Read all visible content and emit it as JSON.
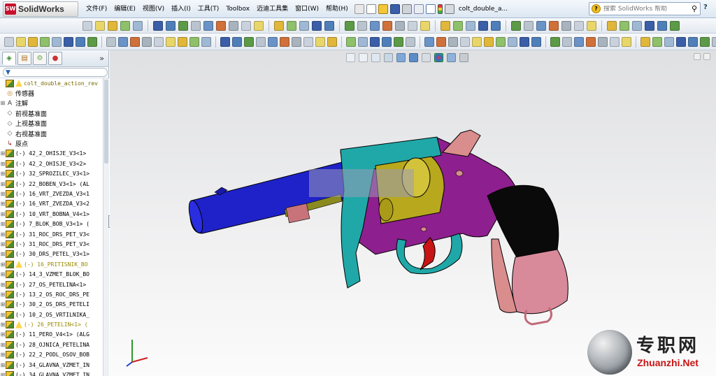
{
  "app": {
    "name": "SolidWorks",
    "logo_mark": "SW"
  },
  "menu": [
    "文件(F)",
    "编辑(E)",
    "视图(V)",
    "插入(I)",
    "工具(T)",
    "Toolbox",
    "迈迪工具集",
    "窗口(W)",
    "帮助(H)"
  ],
  "document_title": "colt_double_a...",
  "search": {
    "placeholder": "搜索 SolidWorks 帮助"
  },
  "panel": {
    "expand_glyph": "»",
    "filter_glyph": "▼"
  },
  "tree": {
    "root": "colt_double_action_rev",
    "items": [
      {
        "label": "传感器",
        "type": "sensor",
        "cn": true
      },
      {
        "label": "注解",
        "type": "annotation",
        "cn": true,
        "expandable": true
      },
      {
        "label": "前视基准面",
        "type": "plane",
        "cn": true
      },
      {
        "label": "上视基准面",
        "type": "plane",
        "cn": true
      },
      {
        "label": "右视基准面",
        "type": "plane",
        "cn": true
      },
      {
        "label": "原点",
        "type": "origin",
        "cn": true
      },
      {
        "label": "(-) 42_2_OHISJE_V3<1>",
        "type": "part",
        "expandable": true
      },
      {
        "label": "(-) 42_2_OHISJE_V3<2>",
        "type": "part",
        "expandable": true
      },
      {
        "label": "(-) 32_SPROZILEC_V3<1>",
        "type": "part",
        "expandable": true
      },
      {
        "label": "(-) 22_BOBEN_V3<1> (AL",
        "type": "part",
        "expandable": true
      },
      {
        "label": "(-) 16_VRT_ZVEZDA_V3<1",
        "type": "part",
        "expandable": true
      },
      {
        "label": "(-) 16_VRT_ZVEZDA_V3<2",
        "type": "part",
        "expandable": true
      },
      {
        "label": "(-) 10_VRT_BOBNA_V4<1>",
        "type": "part",
        "expandable": true
      },
      {
        "label": "(-) 7_BLOK_BOB_V3<1> (",
        "type": "part",
        "expandable": true
      },
      {
        "label": "(-) 31_ROC_DRS_PET_V3<",
        "type": "part",
        "expandable": true
      },
      {
        "label": "(-) 31_ROC_DRS_PET_V3<",
        "type": "part",
        "expandable": true
      },
      {
        "label": "(-) 30_DRS_PETEL_V3<1>",
        "type": "part",
        "expandable": true
      },
      {
        "label": "(-) 16_PRITISNIK_BO",
        "type": "part",
        "expandable": true,
        "warning": true
      },
      {
        "label": "(-) 14_3_VZMET_BLOK_BO",
        "type": "part",
        "expandable": true
      },
      {
        "label": "(-) 27_OS_PETELINA<1>",
        "type": "part",
        "expandable": true
      },
      {
        "label": "(-) 13_2_OS_ROC_DRS_PE",
        "type": "part",
        "expandable": true
      },
      {
        "label": "(-) 30_2_OS_DRS_PETELI",
        "type": "part",
        "expandable": true
      },
      {
        "label": "(-) 10_2_OS_VRTILNIKA_",
        "type": "part",
        "expandable": true
      },
      {
        "label": "(-) 26_PETELIN<1> (",
        "type": "part",
        "expandable": true,
        "warning": true
      },
      {
        "label": "(-) 11_PERO_V4<1> (ALG",
        "type": "part",
        "expandable": true
      },
      {
        "label": "(-) 28_OJNICA_PETELINA",
        "type": "part",
        "expandable": true
      },
      {
        "label": "(-) 22_2_PODL_OSOV_BOB",
        "type": "part",
        "expandable": true
      },
      {
        "label": "(-) 34_GLAVNA_VZMET_IN",
        "type": "part",
        "expandable": true
      },
      {
        "label": "(-) 34_GLAVNA_VZMET_IN",
        "type": "part",
        "expandable": true
      }
    ]
  },
  "watermark": {
    "cn": "专职网",
    "en": "Zhuanzhi.Net"
  },
  "colors": {
    "barrel": "#1f22c8",
    "frame": "#8e1f8e",
    "cylinder_cover": "#20a8a8",
    "cylinder": "#b7a81e",
    "grip": "#0a0a0a",
    "grip_lower": "#d88a9a",
    "trigger": "#c81414",
    "hammer": "#d98d8d"
  }
}
